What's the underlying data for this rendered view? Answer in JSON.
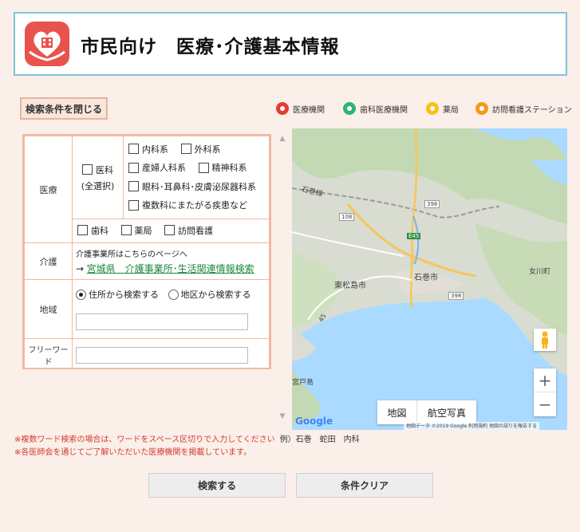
{
  "header": {
    "title": "市民向け　医療･介護基本情報"
  },
  "search": {
    "close_label": "検索条件を閉じる"
  },
  "legend": [
    {
      "label": "医療機関",
      "color": "#e63b2e"
    },
    {
      "label": "歯科医療機関",
      "color": "#2bb673"
    },
    {
      "label": "薬局",
      "color": "#f3c318"
    },
    {
      "label": "訪問看護ステーション",
      "color": "#f29b1a"
    }
  ],
  "form": {
    "medical": {
      "label": "医療",
      "all_label": "医科",
      "all_sub": "(全選択)",
      "options": [
        "内科系",
        "外科系",
        "産婦人科系",
        "精神科系",
        "眼科･耳鼻科･皮膚泌尿器科系",
        "複数科にまたがる疾患など"
      ],
      "extra": [
        "歯科",
        "薬局",
        "訪問看護"
      ]
    },
    "care": {
      "label": "介護",
      "text": "介護事業所はこちらのページへ",
      "arrow": "→",
      "link": "宮城県　介護事業所･生活関連情報検索"
    },
    "area": {
      "label": "地域",
      "option_address": "住所から検索する",
      "option_map": "地区から検索する"
    },
    "freeword": {
      "label": "フリーワード"
    }
  },
  "map": {
    "labels": {
      "ishimaki_line": "石巻線",
      "route108": "108",
      "route398": "398",
      "e45": "E45",
      "higashimatsushima": "東松島市",
      "ishinomaki": "石巻市",
      "route_sm": "398",
      "r45": "45",
      "onagawa": "女川町",
      "miyato": "宮戸島"
    },
    "type_map": "地図",
    "type_satellite": "航空写真",
    "zoom_in": "+",
    "zoom_out": "−",
    "google": "Google",
    "attribution": "地図データ ©2019 Google   利用規約   地図の誤りを報告する"
  },
  "notes": {
    "line1": "※複数ワード検索の場合は、ワードをスペース区切りで入力してください",
    "line1_example": "例）石巻　蛇田　内科",
    "line2": "※各医師会を通じてご了解いただいた医療機関を掲載しています。"
  },
  "buttons": {
    "search": "検索する",
    "clear": "条件クリア"
  }
}
